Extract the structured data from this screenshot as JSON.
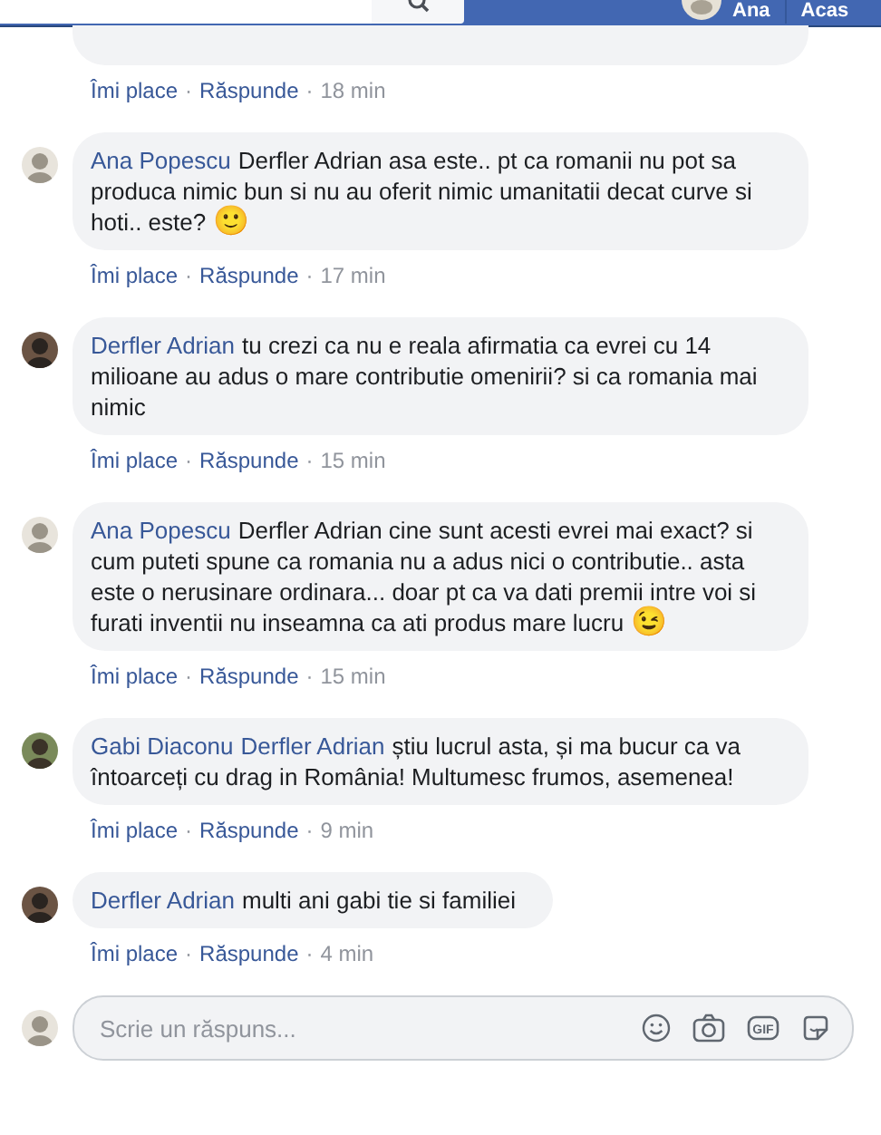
{
  "top_bar": {
    "user_name": "Ana",
    "home_link": "Acas"
  },
  "comments": [
    {
      "partial": true,
      "like": "Îmi place",
      "reply": "Răspunde",
      "time": "18 min",
      "separators": [
        "·",
        "·"
      ]
    },
    {
      "author": "Ana Popescu",
      "text": "Derfler Adrian asa este.. pt ca romanii nu pot sa produca nimic bun si nu au oferit nimic umanitatii decat curve si hoti.. este?",
      "emoji": "🙂",
      "like": "Îmi place",
      "reply": "Răspunde",
      "time": "17 min",
      "separators": [
        "·",
        "·"
      ]
    },
    {
      "author": "Derfler Adrian",
      "text": "tu crezi ca nu e reala afirmatia ca evrei cu 14 milioane au adus o mare contributie omenirii? si ca romania mai nimic",
      "like": "Îmi place",
      "reply": "Răspunde",
      "time": "15 min",
      "separators": [
        "·",
        "·"
      ]
    },
    {
      "author": "Ana Popescu",
      "text": "Derfler Adrian cine sunt acesti evrei mai exact? si cum puteti spune ca romania nu a adus nici o contributie.. asta este o nerusinare ordinara... doar pt ca va dati premii intre voi si furati inventii nu inseamna ca ati produs mare lucru",
      "emoji": "😉",
      "like": "Îmi place",
      "reply": "Răspunde",
      "time": "15 min",
      "separators": [
        "·",
        "·"
      ]
    },
    {
      "author": "Gabi Diaconu",
      "mention": "Derfler Adrian",
      "text": "știu lucrul asta, și ma bucur ca va întoarceți cu drag in România! Multumesc frumos, asemenea!",
      "like": "Îmi place",
      "reply": "Răspunde",
      "time": "9 min",
      "separators": [
        "·",
        "·"
      ]
    },
    {
      "author": "Derfler Adrian",
      "text": "multi ani gabi tie si familiei",
      "like": "Îmi place",
      "reply": "Răspunde",
      "time": "4 min",
      "separators": [
        "·",
        "·"
      ]
    }
  ],
  "composer": {
    "placeholder": "Scrie un răspuns...",
    "gif_label": "GIF"
  }
}
